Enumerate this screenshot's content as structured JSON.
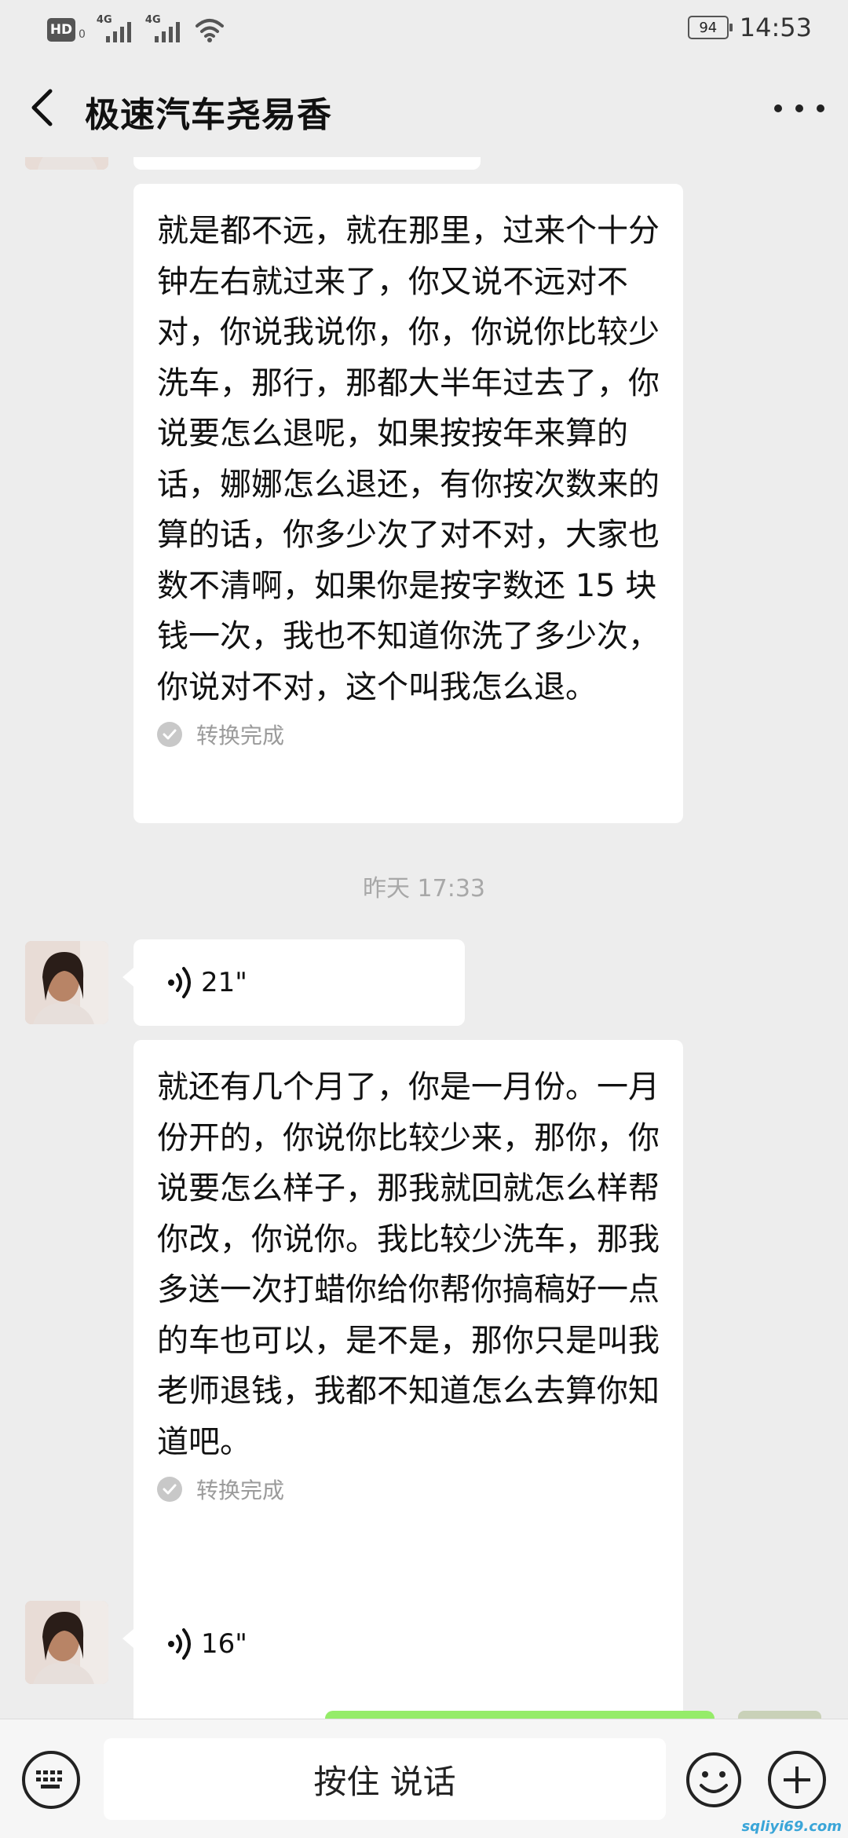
{
  "status_bar": {
    "hd_label": "HD",
    "hd_sub": "0",
    "network_1": "4G",
    "network_2": "4G",
    "battery": "94",
    "time": "14:53"
  },
  "header": {
    "title": "极速汽车尧易香"
  },
  "messages": {
    "transcript_1": "就是都不远，就在那里，过来个十分钟左右就过来了，你又说不远对不对，你说我说你，你，你说你比较少洗车，那行，那都大半年过去了，你说要怎么退呢，如果按按年来算的话，娜娜怎么退还，有你按次数来的算的话，你多少次了对不对，大家也数不清啊，如果你是按字数还 15 块钱一次，我也不知道你洗了多少次，你说对不对，这个叫我怎么退。",
    "transcript_1_status": "转换完成",
    "timestamp": "昨天 17:33",
    "voice_1_duration": "21\"",
    "transcript_2": "就还有几个月了，你是一月份。一月份开的，你说你比较少来，那你，你说要怎么样子，那我就回就怎么样帮你改，你说你。我比较少洗车，那我多送一次打蜡你给你帮你搞稿好一点的车也可以，是不是，那你只是叫我老师退钱，我都不知道怎么去算你知道吧。",
    "transcript_2_status": "转换完成",
    "voice_2_duration": "16\""
  },
  "input_bar": {
    "hold_to_talk": "按住 说话"
  },
  "watermark": "sqliyi69.com",
  "colors": {
    "background": "#ededed",
    "bubble_incoming": "#ffffff",
    "bubble_outgoing": "#95ec69",
    "timestamp_text": "#a8a8a8"
  },
  "icons": [
    "back-arrow-icon",
    "more-dots-icon",
    "voice-wave-icon",
    "check-icon",
    "keyboard-icon",
    "emoji-icon",
    "plus-icon",
    "wifi-icon",
    "signal-icon",
    "battery-icon"
  ]
}
